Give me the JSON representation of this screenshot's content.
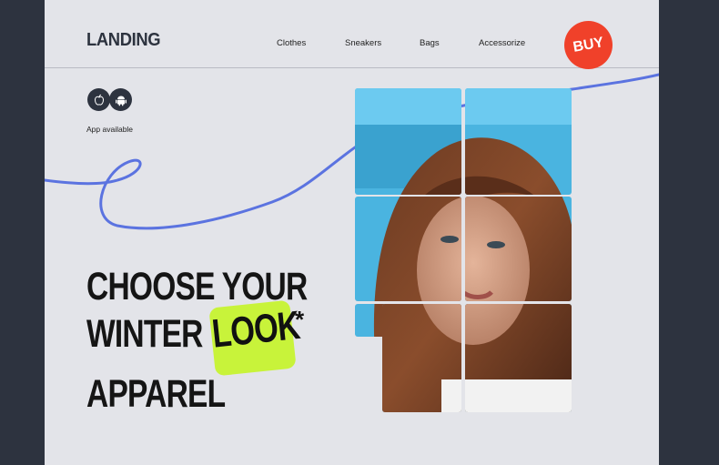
{
  "header": {
    "logo": "LANDING",
    "nav": [
      "Clothes",
      "Sneakers",
      "Bags",
      "Accessorize"
    ],
    "buy_label": "BUY"
  },
  "app": {
    "icons": [
      "apple-icon",
      "android-icon"
    ],
    "label": "App available"
  },
  "hero": {
    "line1": "CHOOSE YOUR",
    "line2": "WINTER",
    "highlight": "LOOK",
    "asterisk": "*",
    "line3": "APPAREL"
  },
  "colors": {
    "background": "#e3e4e9",
    "frame": "#2d333f",
    "accent_buy": "#f0412a",
    "highlight": "#c8f33a",
    "curve": "#5b73e0"
  }
}
